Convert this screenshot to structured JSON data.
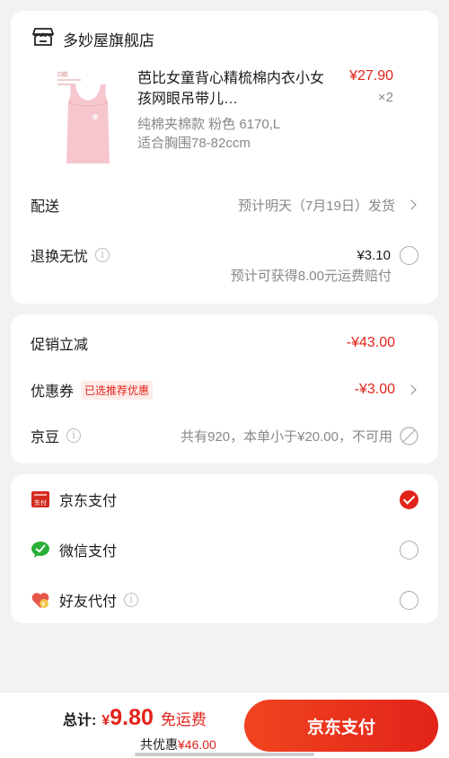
{
  "shop": {
    "name": "多妙屋旗舰店",
    "product": {
      "title": "芭比女童背心精梳棉内衣小女孩网眼吊带儿…",
      "price": "¥27.90",
      "quantity": "×2",
      "spec_line1": "纯棉夹棉款 粉色 6170,L",
      "spec_line2": "适合胸围78-82ccm"
    },
    "delivery": {
      "label": "配送",
      "value": "预计明天（7月19日）发货"
    },
    "return": {
      "label": "退换无忧",
      "price": "¥3.10",
      "note": "预计可获得8.00元运费赔付"
    }
  },
  "discounts": {
    "promo": {
      "label": "促销立减",
      "value": "-¥43.00"
    },
    "coupon": {
      "label": "优惠券",
      "badge": "已选推荐优惠",
      "value": "-¥3.00"
    },
    "jingdou": {
      "label": "京豆",
      "note": "共有920，本单小于¥20.00，不可用"
    }
  },
  "payment_methods": [
    {
      "label": "京东支付",
      "icon": "jd-pay-icon",
      "selected": true
    },
    {
      "label": "微信支付",
      "icon": "wechat-pay-icon",
      "selected": false
    },
    {
      "label": "好友代付",
      "icon": "friend-pay-icon",
      "selected": false
    }
  ],
  "footer": {
    "total_label": "总计:",
    "currency": "¥",
    "total_value": "9.80",
    "free_shipping": "免运费",
    "saving_label": "共优惠",
    "saving_value": "¥46.00",
    "pay_button": "京东支付"
  },
  "colors": {
    "accent": "#e2231a",
    "background": "#f2f2f2"
  }
}
